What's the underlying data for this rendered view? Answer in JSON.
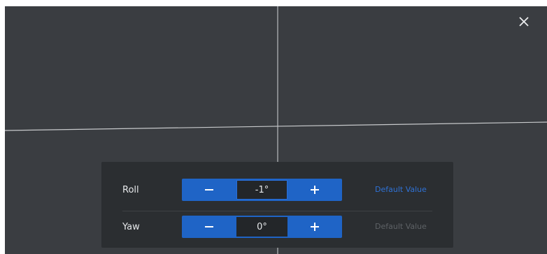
{
  "dialog": {
    "close_icon": "close-icon",
    "controls": [
      {
        "key": "roll",
        "label": "Roll",
        "value": "-1°",
        "decrease_icon": "minus-icon",
        "increase_icon": "plus-icon",
        "default_label": "Default Value",
        "default_enabled": true
      },
      {
        "key": "yaw",
        "label": "Yaw",
        "value": "0°",
        "decrease_icon": "minus-icon",
        "increase_icon": "plus-icon",
        "default_label": "Default Value",
        "default_enabled": false
      }
    ]
  },
  "colors": {
    "viewport_bg": "#3a3d41",
    "panel_bg": "#2b2e31",
    "accent": "#1f64c6",
    "link": "#2f72d6",
    "disabled_text": "#5e6266"
  }
}
